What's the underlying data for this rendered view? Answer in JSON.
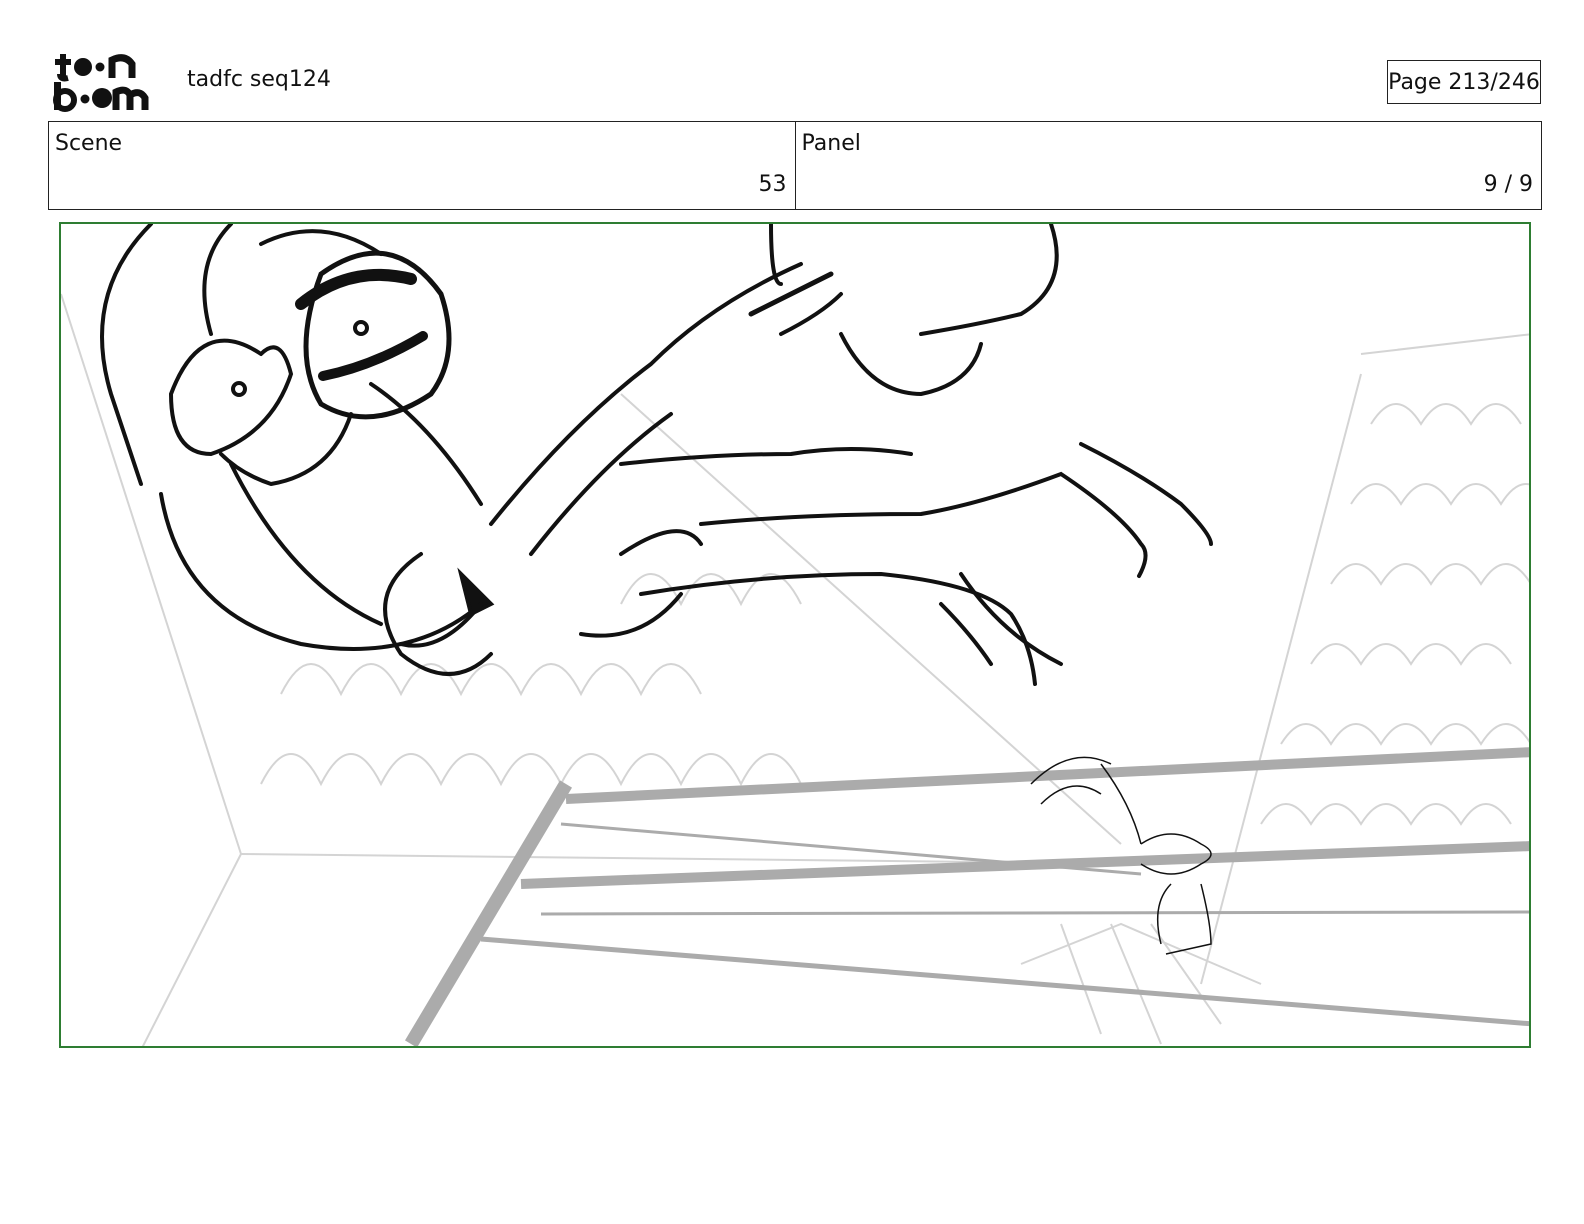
{
  "header": {
    "logo_text": "toon boom",
    "title": "tadfc seq124",
    "page_label": "Page 213/246"
  },
  "info": {
    "scene_label": "Scene",
    "scene_value": "53",
    "panel_label": "Panel",
    "panel_value": "9 / 9"
  },
  "panel_border_color": "#2e7d32"
}
